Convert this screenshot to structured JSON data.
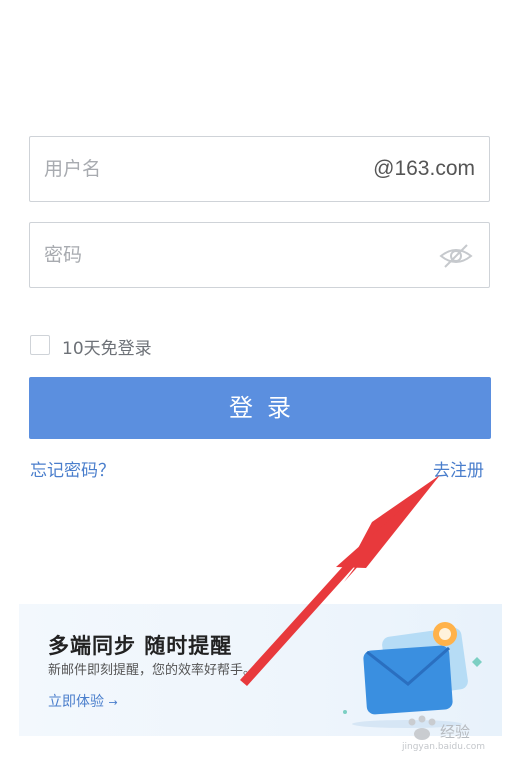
{
  "form": {
    "username_placeholder": "用户名",
    "username_suffix": "@163.com",
    "password_placeholder": "密码",
    "remember_label": "10天免登录",
    "login_label": "登录",
    "forgot_label": "忘记密码？",
    "register_label": "去注册"
  },
  "banner": {
    "title": "多端同步 随时提醒",
    "subtitle": "新邮件即刻提醒，您的效率好帮手。",
    "cta_label": "立即体验",
    "cta_arrow": "→"
  },
  "watermark": {
    "text": "经验",
    "url": "jingyan.baidu.com"
  },
  "colors": {
    "primary": "#5b8fdf",
    "link": "#4a7ecc",
    "annotation_arrow": "#e8393c"
  },
  "icons": [
    "eye-hidden-icon",
    "annotation-arrow",
    "mail-illustration",
    "baidu-paw-icon"
  ]
}
